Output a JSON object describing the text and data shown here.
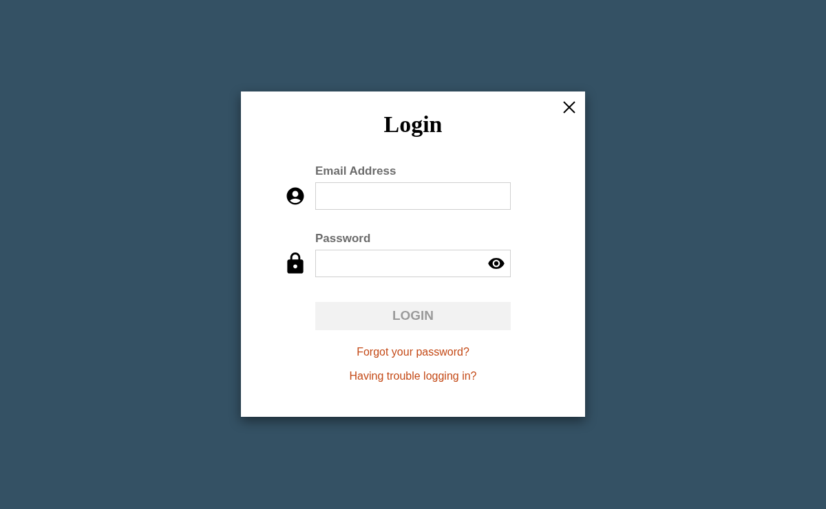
{
  "dialog": {
    "title": "Login",
    "fields": [
      {
        "kind": "email",
        "label": "Email Address"
      },
      {
        "kind": "password",
        "label": "Password"
      }
    ],
    "login_button": {
      "label": "LOGIN",
      "disabled": true
    },
    "links": [
      "Forgot your password?",
      "Having trouble logging in?"
    ]
  }
}
